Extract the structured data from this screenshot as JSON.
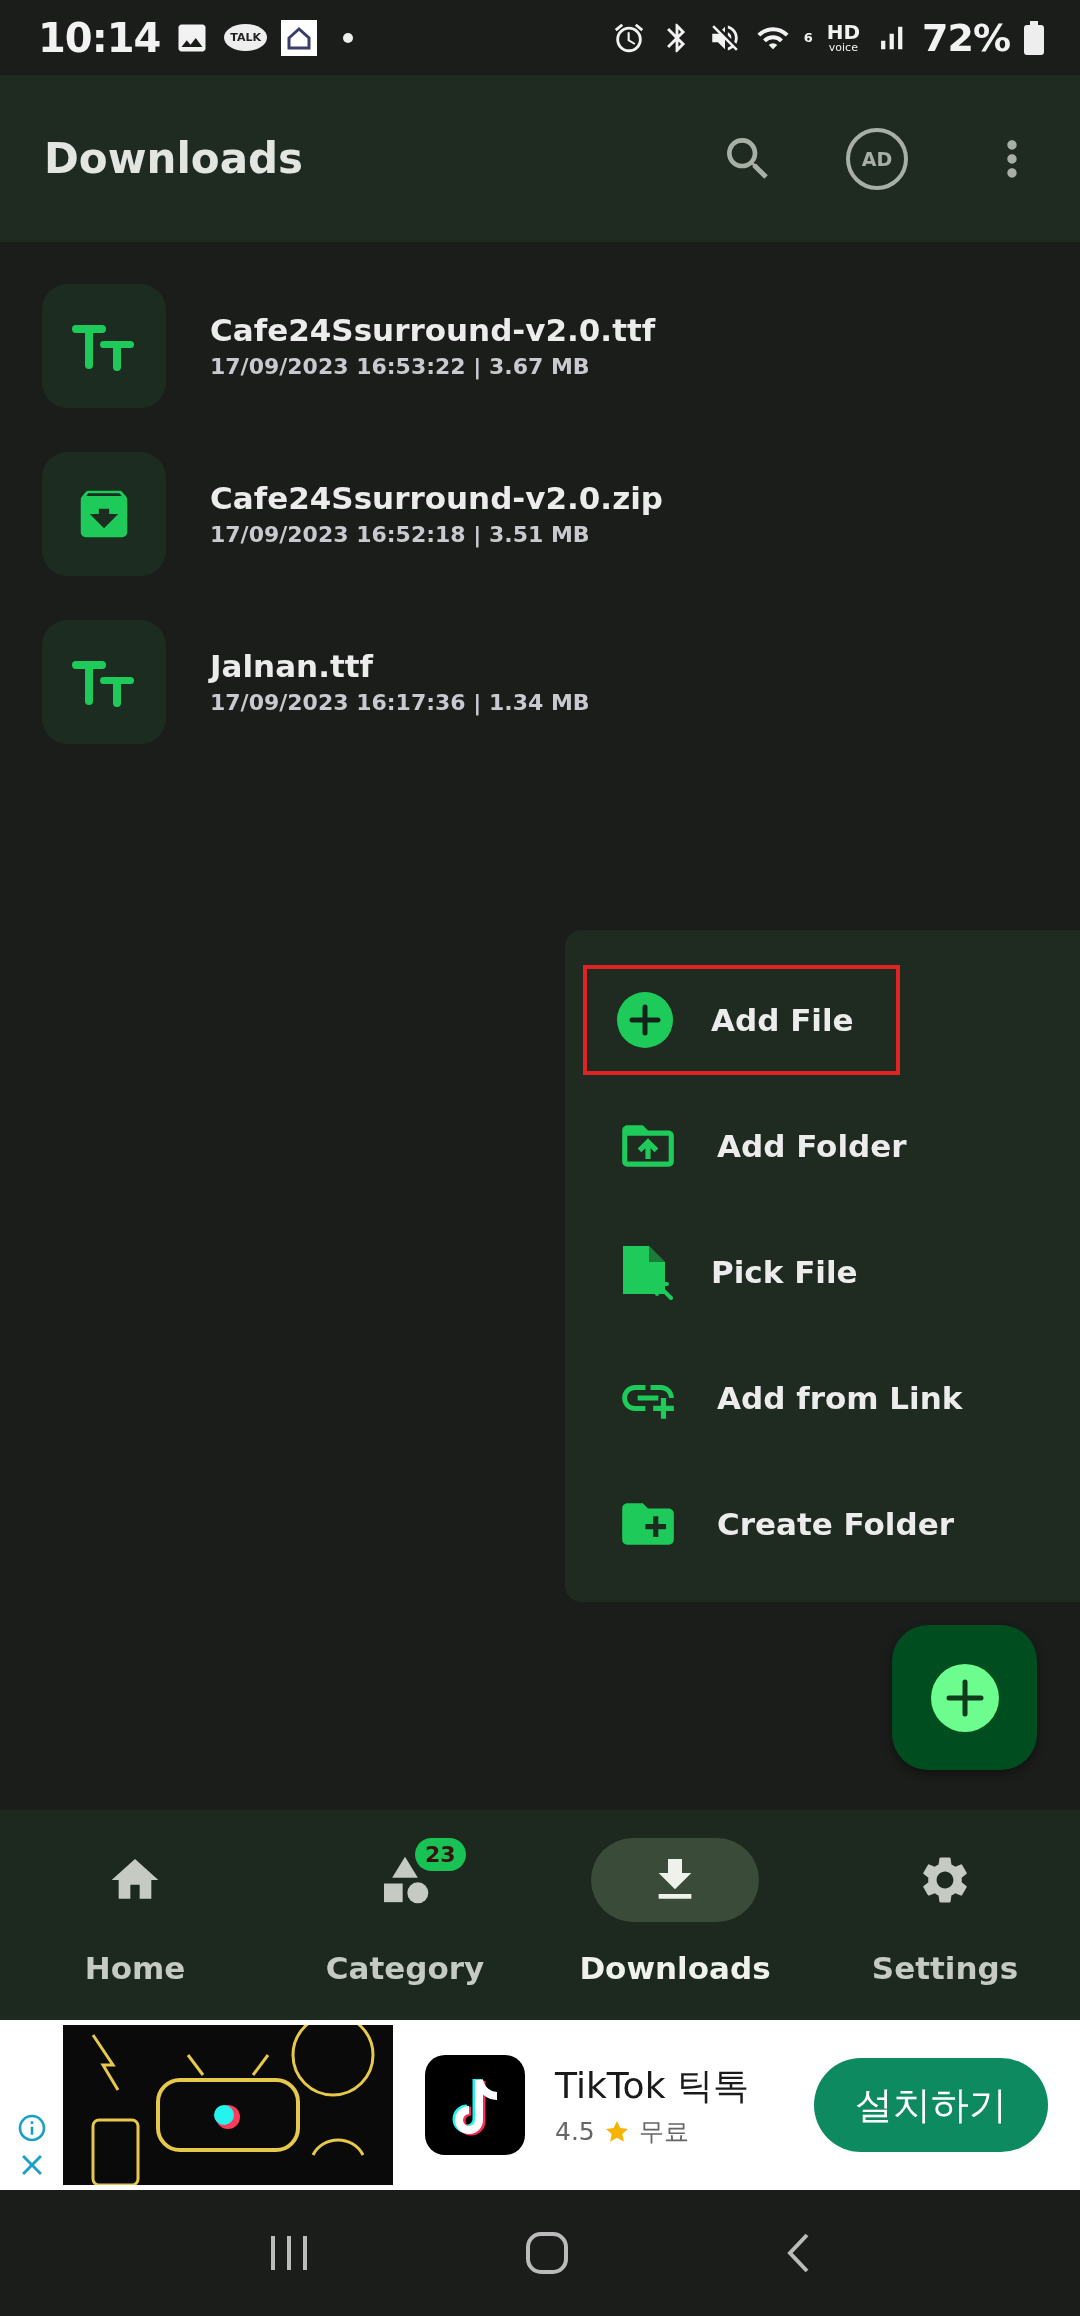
{
  "status_bar": {
    "time": "10:14",
    "talk_badge": "TALK",
    "wifi_generation": "6",
    "hd": "HD",
    "voice": "voice",
    "battery": "72%"
  },
  "app_bar": {
    "title": "Downloads",
    "ad_badge": "AD"
  },
  "files": [
    {
      "kind": "font",
      "name": "Cafe24Ssurround-v2.0.ttf",
      "details": "17/09/2023 16:53:22 | 3.67 MB"
    },
    {
      "kind": "archive",
      "name": "Cafe24Ssurround-v2.0.zip",
      "details": "17/09/2023 16:52:18 | 3.51 MB"
    },
    {
      "kind": "font",
      "name": "Jalnan.ttf",
      "details": "17/09/2023 16:17:36 | 1.34 MB"
    }
  ],
  "add_menu": {
    "items": [
      {
        "kind": "add-file",
        "label": "Add File",
        "highlighted": true
      },
      {
        "kind": "add-folder",
        "label": "Add Folder",
        "highlighted": false
      },
      {
        "kind": "pick-file",
        "label": "Pick File",
        "highlighted": false
      },
      {
        "kind": "add-link",
        "label": "Add from Link",
        "highlighted": false
      },
      {
        "kind": "create-folder",
        "label": "Create Folder",
        "highlighted": false
      }
    ]
  },
  "bottom_nav": {
    "items": [
      {
        "kind": "home",
        "label": "Home",
        "selected": false
      },
      {
        "kind": "category",
        "label": "Category",
        "badge": "23",
        "selected": false
      },
      {
        "kind": "downloads",
        "label": "Downloads",
        "selected": true
      },
      {
        "kind": "settings",
        "label": "Settings",
        "selected": false
      }
    ]
  },
  "ad": {
    "app_name": "TikTok 틱톡",
    "rating": "4.5",
    "price": "무료",
    "button": "설치하기"
  }
}
